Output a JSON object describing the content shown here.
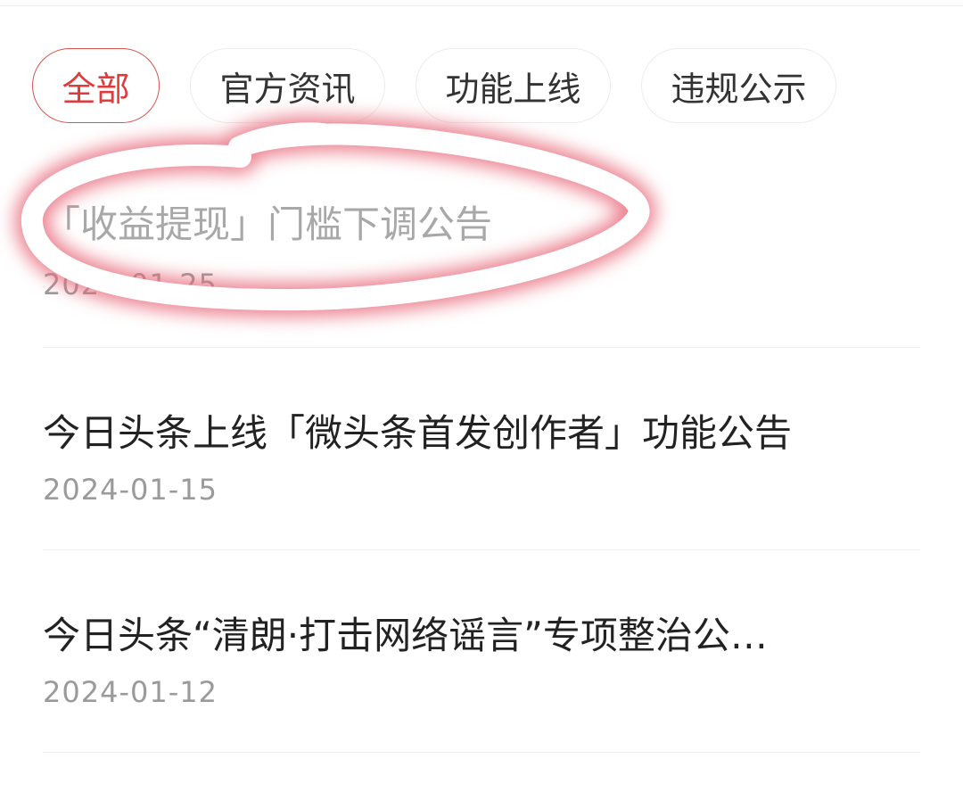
{
  "tabs": [
    {
      "label": "全部",
      "active": true
    },
    {
      "label": "官方资讯",
      "active": false
    },
    {
      "label": "功能上线",
      "active": false
    },
    {
      "label": "违规公示",
      "active": false
    }
  ],
  "announcements": [
    {
      "title": "「收益提现」门槛下调公告",
      "date": "2024-01-25",
      "read": true
    },
    {
      "title": "今日头条上线「微头条首发创作者」功能公告",
      "date": "2024-01-15",
      "read": false
    },
    {
      "title": "今日头条“清朗·打击网络谣言”专项整治公…",
      "date": "2024-01-12",
      "read": false
    }
  ],
  "colors": {
    "accent": "#e03a3a",
    "annotation_glow": "#e8697a",
    "text_primary": "#222222",
    "text_secondary": "#9a9a9a"
  }
}
